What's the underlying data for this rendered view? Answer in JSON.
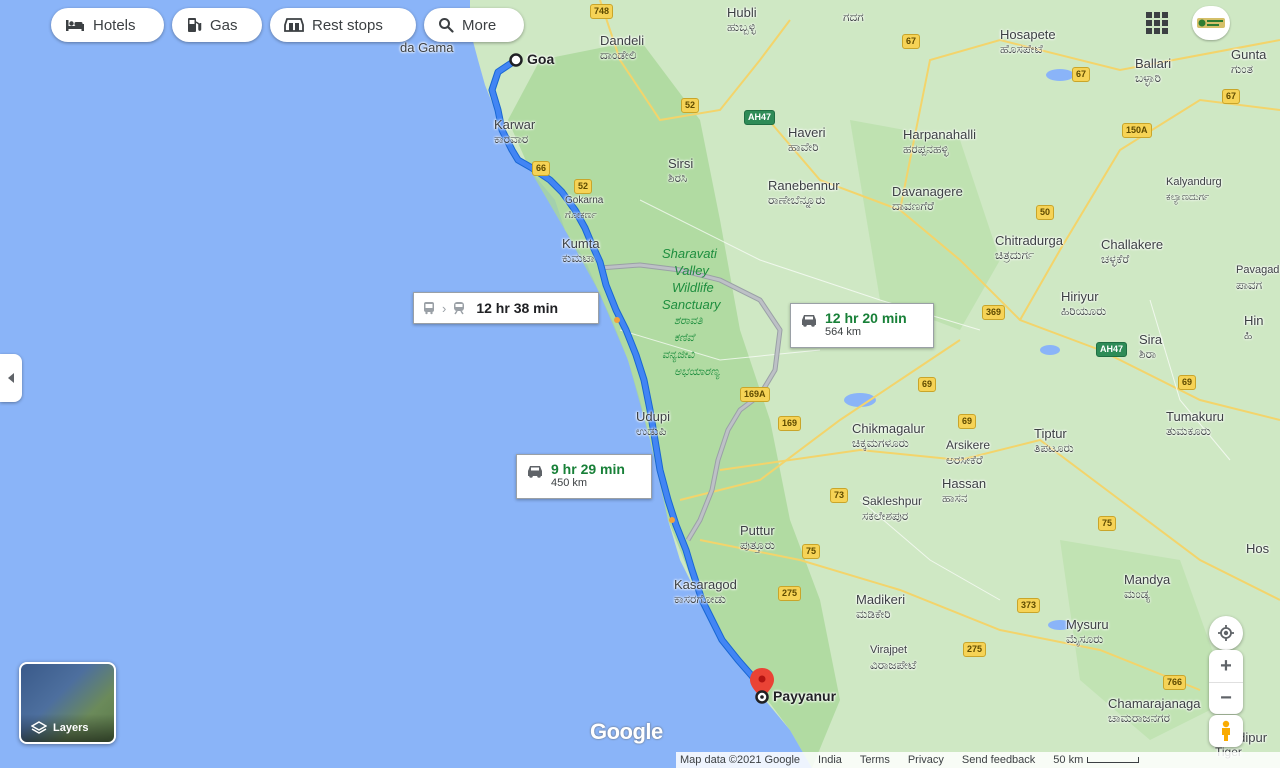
{
  "chips": [
    {
      "label": "Hotels",
      "icon": "bed-icon"
    },
    {
      "label": "Gas",
      "icon": "gas-pump-icon"
    },
    {
      "label": "Rest stops",
      "icon": "rest-stop-icon"
    },
    {
      "label": "More",
      "icon": "search-icon"
    }
  ],
  "places": {
    "origin": "Goa",
    "destination": "Payyanur",
    "panaji": "da Gama",
    "dandeli": {
      "en": "Dandeli",
      "kn": "ದಾಂಡೇಲಿ"
    },
    "hubli": {
      "en": "Hubli",
      "kn": "ಹುಬ್ಬಳ್ಳಿ"
    },
    "gadag": "ಗದಗ",
    "hosapete": {
      "en": "Hosapete",
      "kn": "ಹೊಸಪೇಟೆ"
    },
    "ballari": {
      "en": "Ballari",
      "kn": "ಬಳ್ಳಾರಿ"
    },
    "guntakal": {
      "en": "Gunta",
      "kn": "ಗುಂತ"
    },
    "karwar": {
      "en": "Karwar",
      "kn": "ಕಾರವಾರ"
    },
    "haveri": {
      "en": "Haveri",
      "kn": "ಹಾವೇರಿ"
    },
    "harpanahalli": {
      "en": "Harpanahalli",
      "kn": "ಹರಪ್ಪನಹಳ್ಳಿ"
    },
    "sirsi": {
      "en": "Sirsi",
      "kn": "ಶಿರಸಿ"
    },
    "ranebennur": {
      "en": "Ranebennur",
      "kn": "ರಾಣೇಬೆನ್ನೂರು"
    },
    "davanagere": {
      "en": "Davanagere",
      "kn": "ದಾವಣಗೆರೆ"
    },
    "kalyandurg": {
      "en": "Kalyandurg",
      "kn": "ಕಲ್ಯಾಣದುರ್ಗ"
    },
    "gokarna": {
      "en": "Gokarna",
      "kn": "ಗೋಕರ್ಣ"
    },
    "kumta": {
      "en": "Kumta",
      "kn": "ಕುಮಟಾ"
    },
    "chitradurga": {
      "en": "Chitradurga",
      "kn": "ಚಿತ್ರದುರ್ಗ"
    },
    "challakere": {
      "en": "Challakere",
      "kn": "ಚಳ್ಳಕೆರೆ"
    },
    "pavagada": {
      "en": "Pavagad",
      "kn": "ಪಾವಗ"
    },
    "hiriyur": {
      "en": "Hiriyur",
      "kn": "ಹಿರಿಯೂರು"
    },
    "sira": {
      "en": "Sira",
      "kn": "ಶಿರಾ"
    },
    "hin": {
      "en": "Hin",
      "kn": "ಹಿ"
    },
    "udupi": {
      "en": "Udupi",
      "kn": "ಉಡುಪಿ"
    },
    "chikmagalur": {
      "en": "Chikmagalur",
      "kn": "ಚಿಕ್ಕಮಗಳೂರು"
    },
    "arsikere": {
      "en": "Arsikere",
      "kn": "ಅರಸೀಕೆರೆ"
    },
    "tiptur": {
      "en": "Tiptur",
      "kn": "ತಿಪಟೂರು"
    },
    "tumakuru": {
      "en": "Tumakuru",
      "kn": "ತುಮಕೂರು"
    },
    "hassan": {
      "en": "Hassan",
      "kn": "ಹಾಸನ"
    },
    "sakleshpur": {
      "en": "Sakleshpur",
      "kn": "ಸಕಲೇಶಪುರ"
    },
    "puttur": {
      "en": "Puttur",
      "kn": "ಪುತ್ತೂರು"
    },
    "kasaragod": {
      "en": "Kasaragod",
      "kn": "ಕಾಸರಗೋಡು"
    },
    "mandya": {
      "en": "Mandya",
      "kn": "ಮಂಡ್ಯ"
    },
    "madikeri": {
      "en": "Madikeri",
      "kn": "ಮಡಿಕೇರಿ"
    },
    "mysuru": {
      "en": "Mysuru",
      "kn": "ಮೈಸೂರು"
    },
    "virajpet": {
      "en": "Virajpet",
      "kn": "ವಿರಾಜಪೇಟೆ"
    },
    "chamarajanagar": {
      "en": "Chamarajanaga",
      "kn": "ಚಾಮರಾಜನಗರ"
    },
    "bandipur": {
      "en": "Bandipur",
      "kn": "Tiger"
    },
    "hosur": {
      "en": "Hos"
    },
    "park": {
      "line1": "Sharavati",
      "line2": "Valley",
      "line3": "Wildlife",
      "line4": "Sanctuary",
      "kn1": "ಶರಾವತಿ",
      "kn2": "ಕಣಿವೆ",
      "kn3": "ವನ್ಯಜೀವಿ",
      "kn4": "ಅಭಯಾರಣ್ಯ"
    }
  },
  "routes": [
    {
      "mode": "drive",
      "time": "9 hr 29 min",
      "distance": "450 km",
      "color": "#4285f4"
    },
    {
      "mode": "drive",
      "time": "12 hr 20 min",
      "distance": "564 km",
      "color": "#9aa0a6"
    },
    {
      "mode": "transit",
      "time": "12 hr 38 min",
      "color": "#9aa0a6"
    }
  ],
  "highways": [
    "748",
    "67",
    "67",
    "67",
    "52",
    "AH47",
    "66",
    "52",
    "150A",
    "50",
    "369",
    "AH47",
    "69",
    "69",
    "169A",
    "169",
    "69",
    "73",
    "75",
    "75",
    "275",
    "373",
    "275",
    "766"
  ],
  "layers_label": "Layers",
  "logo": "Google",
  "attribution": {
    "map_data": "Map data ©2021 Google",
    "country": "India",
    "terms": "Terms",
    "privacy": "Privacy",
    "feedback": "Send feedback",
    "scale": "50 km"
  },
  "colors": {
    "water": "#8ab4f8",
    "land": "#cfe8c4",
    "route": "#4285f4",
    "alt_route": "#9aa0a6",
    "pin": "#ea4335"
  }
}
